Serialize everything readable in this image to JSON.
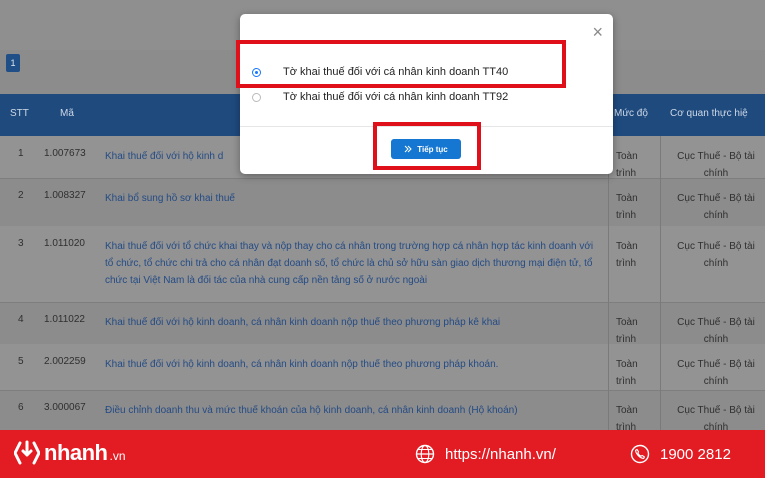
{
  "pagination": {
    "current_page": "1"
  },
  "table": {
    "headers": [
      "STT",
      "Mã",
      "Mức độ",
      "Cơ quan thực hiệ"
    ],
    "rows": [
      {
        "stt": "1",
        "ma": "1.007673",
        "ten": "Khai thuế đối với hộ kinh d",
        "muc_do": "Toàn trình",
        "co_quan": "Cục Thuế - Bộ tài chính"
      },
      {
        "stt": "2",
        "ma": "1.008327",
        "ten": "Khai bổ sung hồ sơ khai thuế",
        "muc_do": "Toàn trình",
        "co_quan": "Cục Thuế - Bộ tài chính"
      },
      {
        "stt": "3",
        "ma": "1.011020",
        "ten": "Khai thuế đối với tổ chức khai thay và nộp thay cho cá nhân trong trường hợp cá nhân hợp tác kinh doanh với tổ chức, tổ chức chi trả cho cá nhân đạt doanh số, tổ chức là chủ sở hữu sàn giao dịch thương mại điện tử, tổ chức tại Việt Nam là đối tác của nhà cung cấp nền tảng số ở nước ngoài",
        "muc_do": "Toàn trình",
        "co_quan": "Cục Thuế - Bộ tài chính"
      },
      {
        "stt": "4",
        "ma": "1.011022",
        "ten": "Khai thuế đối với hộ kinh doanh, cá nhân kinh doanh nộp thuế theo phương pháp kê khai",
        "muc_do": "Toàn trình",
        "co_quan": "Cục Thuế - Bộ tài chính"
      },
      {
        "stt": "5",
        "ma": "2.002259",
        "ten": "Khai thuế đối với hộ kinh doanh, cá nhân kinh doanh nộp thuế theo phương pháp khoán.",
        "muc_do": "Toàn trình",
        "co_quan": "Cục Thuế - Bộ tài chính"
      },
      {
        "stt": "6",
        "ma": "3.000067",
        "ten": "Điều chỉnh doanh thu và mức thuế khoán của hộ kinh doanh, cá nhân kinh doanh (Hộ khoán)",
        "muc_do": "Toàn trình",
        "co_quan": "Cục Thuế - Bộ tài chính"
      }
    ]
  },
  "modal": {
    "close_icon": "×",
    "options": [
      {
        "label": "Tờ khai thuế đối với cá nhân kinh doanh TT40",
        "selected": true
      },
      {
        "label": "Tờ khai thuế đối với cá nhân kinh doanh TT92",
        "selected": false
      }
    ],
    "continue_label": "Tiếp tục",
    "highlight_color": "#e0101a"
  },
  "footer": {
    "brand": "nhanh",
    "brand_suffix": ".vn",
    "website": "https://nhanh.vn/",
    "phone": "1900 2812",
    "background": "#e31b23"
  }
}
